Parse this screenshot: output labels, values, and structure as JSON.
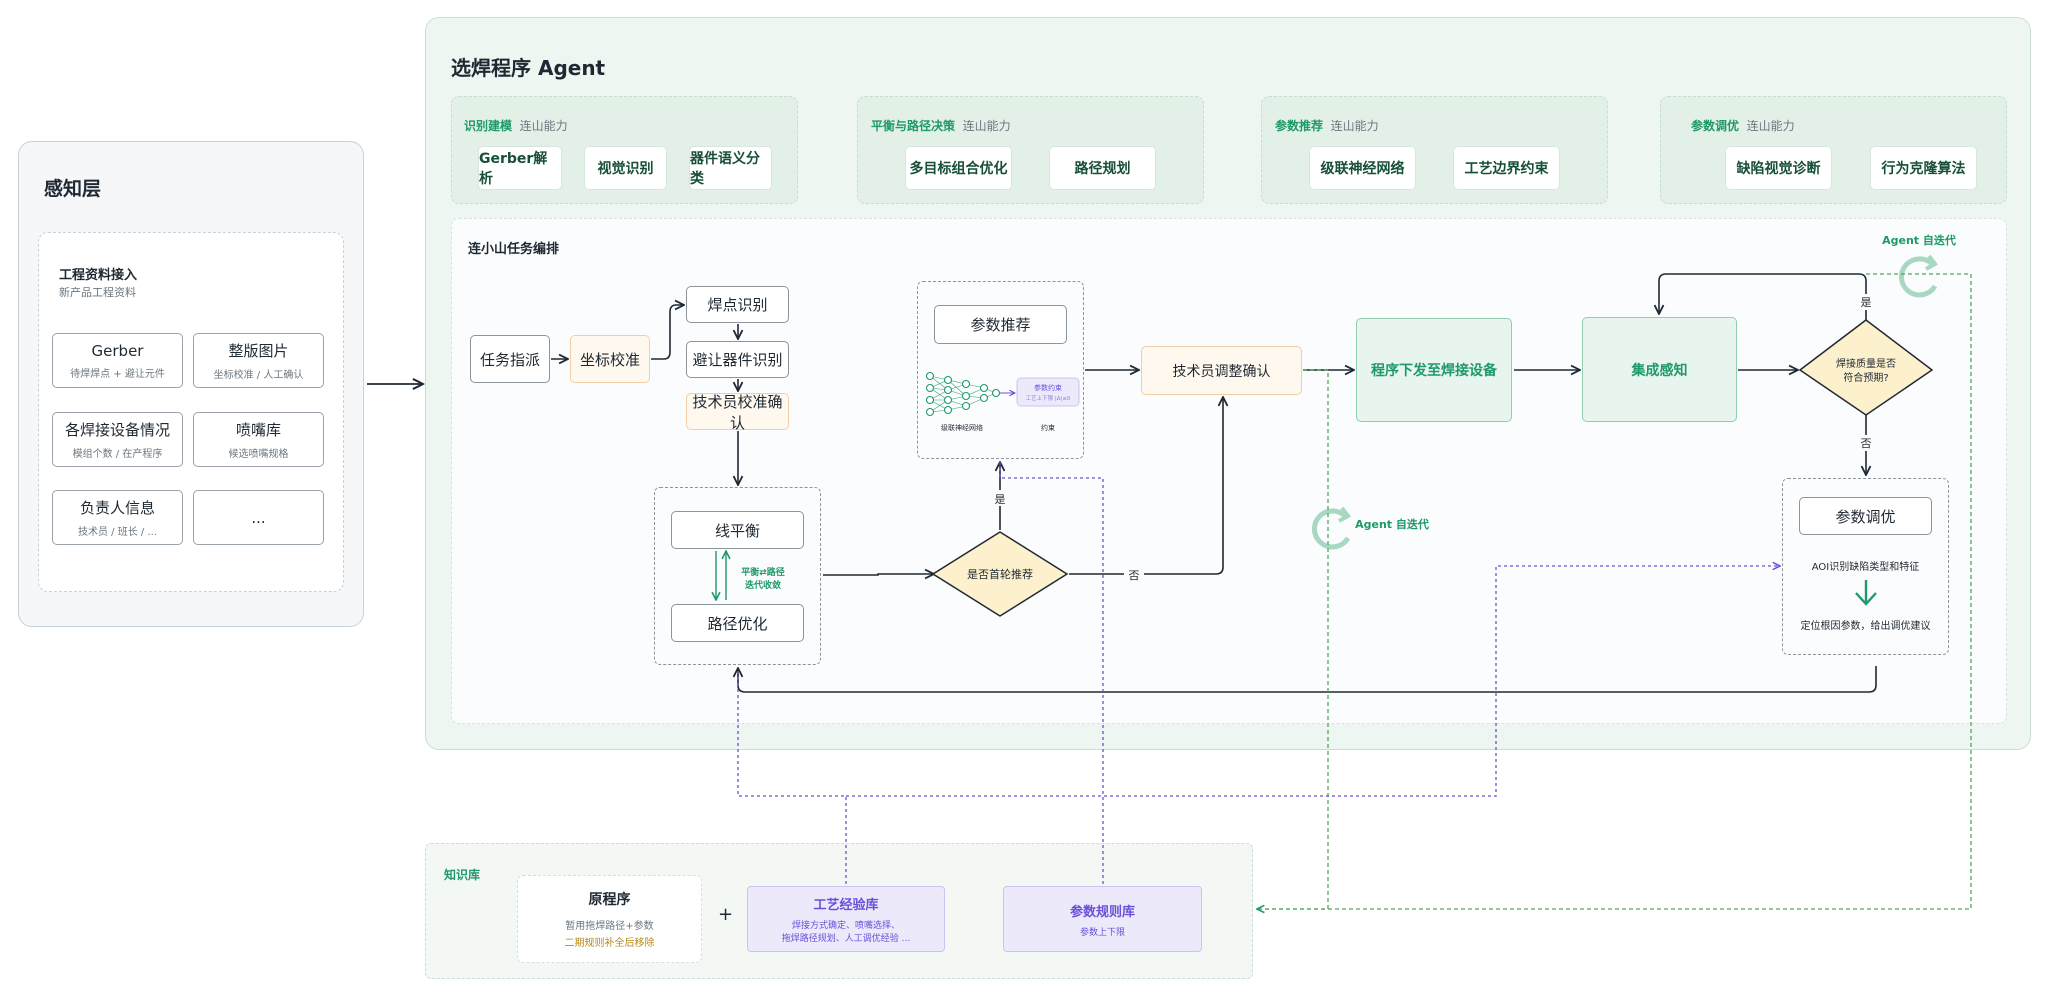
{
  "perception": {
    "title": "感知层",
    "intake_title": "工程资料接入",
    "intake_subtitle": "新产品工程资料",
    "cards": [
      {
        "title": "Gerber",
        "subtitle": "待焊焊点 + 避让元件"
      },
      {
        "title": "整版图片",
        "subtitle": "坐标校准 / 人工确认"
      },
      {
        "title": "各焊接设备情况",
        "subtitle": "模组个数 / 在产程序"
      },
      {
        "title": "喷嘴库",
        "subtitle": "候选喷嘴规格"
      },
      {
        "title": "负责人信息",
        "subtitle": "技术员 / 班长 / ..."
      },
      {
        "title": "...",
        "subtitle": ""
      }
    ]
  },
  "agent": {
    "title": "选焊程序 Agent",
    "capabilities": [
      {
        "name": "识别建模",
        "tag": "连山能力",
        "chips": [
          "Gerber解析",
          "视觉识别",
          "器件语义分类"
        ]
      },
      {
        "name": "平衡与路径决策",
        "tag": "连山能力",
        "chips": [
          "多目标组合优化",
          "路径规划"
        ]
      },
      {
        "name": "参数推荐",
        "tag": "连山能力",
        "chips": [
          "级联神经网络",
          "工艺边界约束"
        ]
      },
      {
        "name": "参数调优",
        "tag": "连山能力",
        "chips": [
          "缺陷视觉诊断",
          "行为克隆算法"
        ]
      }
    ],
    "orchestration_title": "连小山任务编排"
  },
  "flow": {
    "task_assign": "任务指派",
    "coord_calib": "坐标校准",
    "solder_point": "焊点识别",
    "avoid_part": "避让器件识别",
    "tech_calib_confirm": "技术员校准确认",
    "line_balance": "线平衡",
    "balance_note_1": "平衡⇄路径",
    "balance_note_2": "迭代收敛",
    "path_opt": "路径优化",
    "first_round": "是否首轮推荐",
    "yes": "是",
    "no": "否",
    "param_rec": "参数推荐",
    "nn_label": "级联神经网络",
    "constraint_label": "约束",
    "constraint_box_1": "参数约束",
    "constraint_box_2": "工艺上下限 |Δ|≤δ",
    "tech_adjust": "技术员调整确认",
    "dispatch": "程序下发至焊接设备",
    "sensing": "集成感知",
    "quality_q_1": "焊接质量是否",
    "quality_q_2": "符合预期?",
    "param_tune": "参数调优",
    "aoi": "AOI识别缺陷类型和特征",
    "root_cause": "定位根因参数，给出调优建议",
    "agent_iter": "Agent 自迭代"
  },
  "knowledge": {
    "title": "知识库",
    "original_title": "原程序",
    "original_sub": "暂用拖焊路径+参数",
    "original_note": "二期规则补全后移除",
    "plus": "+",
    "process_title": "工艺经验库",
    "process_sub1": "焊接方式确定、喷嘴选择、",
    "process_sub2": "拖焊路径规划、人工调优经验 ...",
    "param_title": "参数规则库",
    "param_sub": "参数上下限"
  },
  "colors": {
    "accent_green": "#1f9968",
    "panel_green_bg": "#eef6f1",
    "purple": "#6b4fd8",
    "purple_bg": "#ece9fb",
    "diamond_fill": "#fdf0cc",
    "peach_fill": "#fff8ee"
  }
}
